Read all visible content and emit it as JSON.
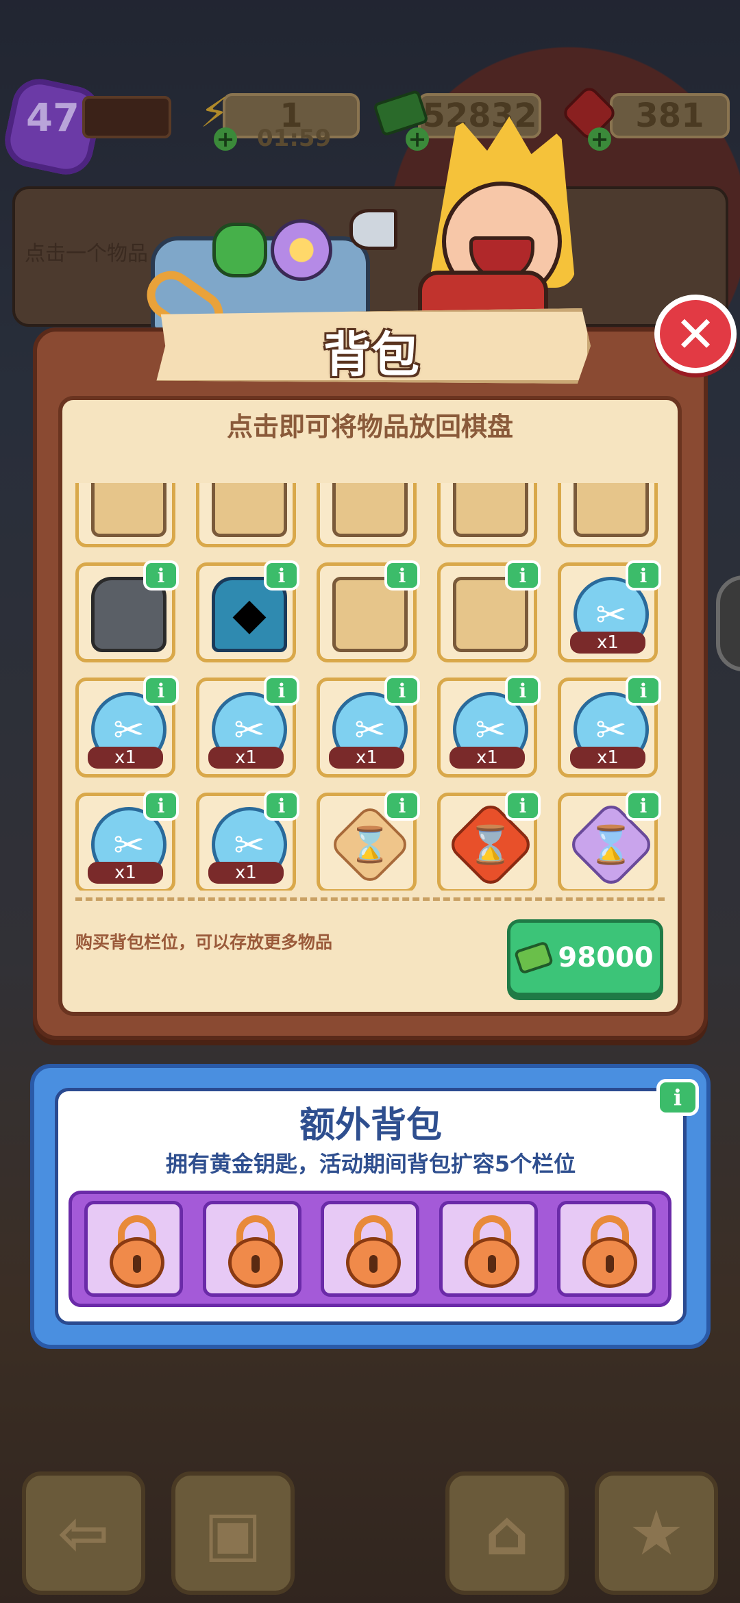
{
  "hud": {
    "level": "47",
    "xp_progress": 0.0,
    "energy_value": "1",
    "energy_timer": "01:59",
    "cash_value": "52832",
    "gem_value": "381",
    "icons": {
      "energy": "lightning-icon",
      "cash": "cash-icon",
      "gem": "ruby-icon"
    }
  },
  "hint_bar": {
    "text": "点击一个物品"
  },
  "backpack_panel": {
    "title": "背包",
    "subtitle": "点击即可将物品放回棋盘",
    "info_badge_label": "i",
    "slots": [
      {
        "icon": "partial-item-icon",
        "quantity": ""
      },
      {
        "icon": "partial-item-icon",
        "quantity": ""
      },
      {
        "icon": "partial-item-icon",
        "quantity": ""
      },
      {
        "icon": "partial-item-icon",
        "quantity": ""
      },
      {
        "icon": "partial-item-icon",
        "quantity": ""
      },
      {
        "icon": "backpack-icon",
        "quantity": ""
      },
      {
        "icon": "treasure-chest-icon",
        "quantity": ""
      },
      {
        "icon": "toolbox-icon",
        "quantity": ""
      },
      {
        "icon": "toolbox-icon",
        "quantity": ""
      },
      {
        "icon": "scissors-cloud-icon",
        "quantity": "x1"
      },
      {
        "icon": "scissors-cloud-icon",
        "quantity": "x1"
      },
      {
        "icon": "scissors-cloud-icon",
        "quantity": "x1"
      },
      {
        "icon": "scissors-cloud-icon",
        "quantity": "x1"
      },
      {
        "icon": "scissors-cloud-icon",
        "quantity": "x1"
      },
      {
        "icon": "scissors-cloud-icon",
        "quantity": "x1"
      },
      {
        "icon": "scissors-cloud-icon",
        "quantity": "x1"
      },
      {
        "icon": "scissors-cloud-icon",
        "quantity": "x1"
      },
      {
        "icon": "hourglass-tan-icon",
        "quantity": ""
      },
      {
        "icon": "hourglass-red-icon",
        "quantity": ""
      },
      {
        "icon": "hourglass-purple-icon",
        "quantity": ""
      },
      {
        "icon": "hourglass-purple-icon",
        "quantity": ""
      },
      {
        "icon": "hourglass-purple-icon",
        "quantity": ""
      },
      {
        "icon": "orange-orb-icon",
        "quantity": ""
      },
      {
        "icon": "ruby-icon",
        "quantity": ""
      },
      {
        "icon": "ticket-icon",
        "quantity": ""
      }
    ],
    "buy_text": "购买背包栏位，可以存放更多物品",
    "buy_price": "98000"
  },
  "extra_backpack": {
    "title": "额外背包",
    "subtitle": "拥有黄金钥匙，活动期间背包扩容5个栏位",
    "locked_slot_count": 5
  },
  "bottom_nav": {
    "icons": [
      "back-arrow-icon",
      "backpack-icon",
      "basket-icon",
      "clipboard-star-icon"
    ]
  }
}
